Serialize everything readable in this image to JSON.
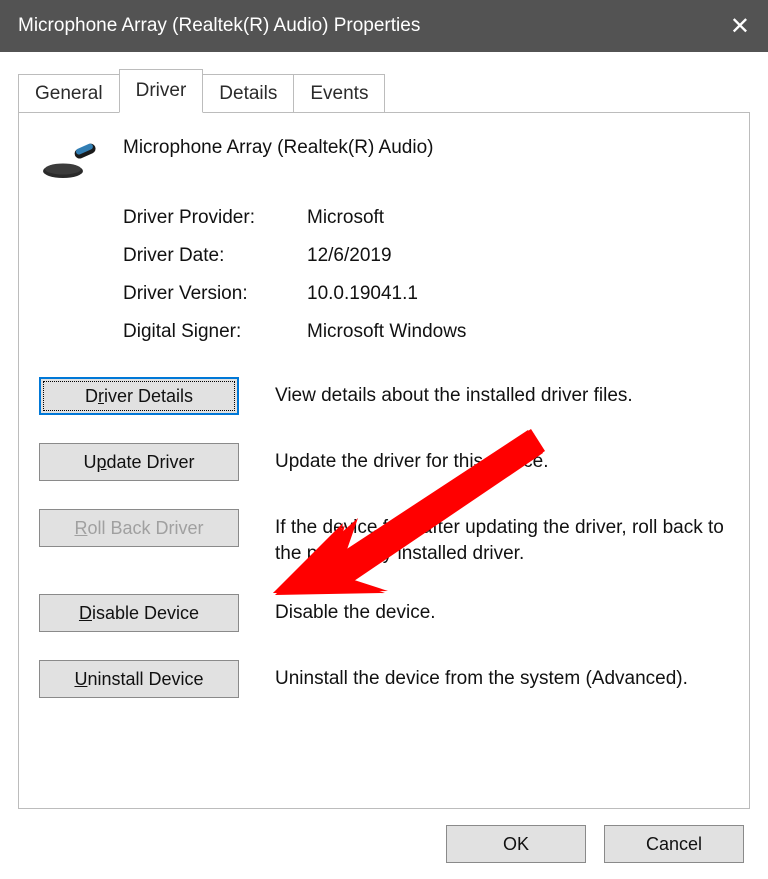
{
  "titlebar": {
    "title": "Microphone Array (Realtek(R) Audio) Properties"
  },
  "tabs": {
    "general": "General",
    "driver": "Driver",
    "details": "Details",
    "events": "Events"
  },
  "device": {
    "name": "Microphone Array (Realtek(R) Audio)"
  },
  "info": {
    "provider_label": "Driver Provider:",
    "provider_value": "Microsoft",
    "date_label": "Driver Date:",
    "date_value": "12/6/2019",
    "version_label": "Driver Version:",
    "version_value": "10.0.19041.1",
    "signer_label": "Digital Signer:",
    "signer_value": "Microsoft Windows"
  },
  "actions": {
    "details_label_pre": "D",
    "details_label_mn": "r",
    "details_label_post": "iver Details",
    "details_desc": "View details about the installed driver files.",
    "update_label_pre": "U",
    "update_label_mn": "p",
    "update_label_post": "date Driver",
    "update_desc": "Update the driver for this device.",
    "rollback_label_pre": "",
    "rollback_label_mn": "R",
    "rollback_label_post": "oll Back Driver",
    "rollback_desc": "If the device fails after updating the driver, roll back to the previously installed driver.",
    "disable_label_pre": "",
    "disable_label_mn": "D",
    "disable_label_post": "isable Device",
    "disable_desc": "Disable the device.",
    "uninstall_label_pre": "",
    "uninstall_label_mn": "U",
    "uninstall_label_post": "ninstall Device",
    "uninstall_desc": "Uninstall the device from the system (Advanced)."
  },
  "footer": {
    "ok": "OK",
    "cancel": "Cancel"
  }
}
